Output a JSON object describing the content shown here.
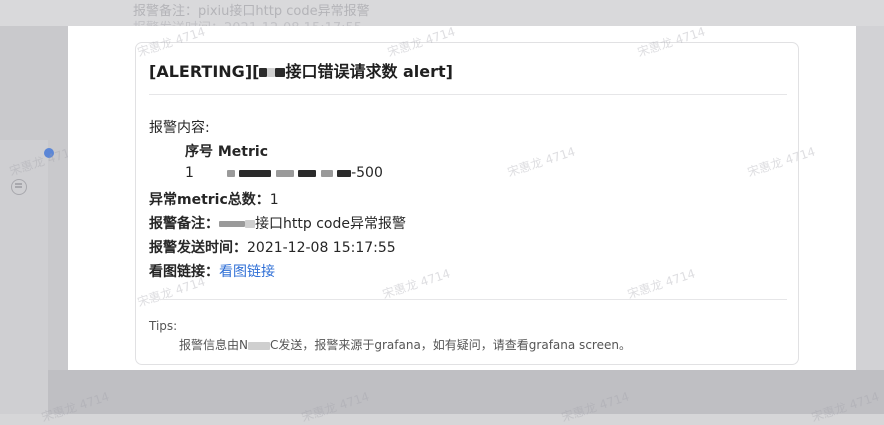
{
  "background": {
    "ghost_line1": "报警备注：pixiu接口http code异常报警",
    "ghost_line2": "报警发送时间：2021-12-08 15:17:55"
  },
  "card": {
    "title_prefix": "[ALERTING][",
    "title_suffix": "接口错误请求数 alert]",
    "content_label": "报警内容:",
    "table_header": "序号 Metric",
    "row_index": "1",
    "row_metric_suffix": "-500",
    "total_label": "异常metric总数：",
    "total_value": "1",
    "note_label": "报警备注：",
    "note_value_suffix": "接口http code异常报警",
    "time_label": "报警发送时间：",
    "time_value": "2021-12-08 15:17:55",
    "graph_label": "看图链接：",
    "graph_link": "看图链接",
    "tips_label": "Tips:",
    "tips_text_a": "报警信息由N",
    "tips_text_b": "C发送，报警来源于grafana，如有疑问，请查看grafana screen。"
  },
  "watermark": {
    "text": "宋惠龙 4714"
  },
  "colors": {
    "link": "#2f6fd6",
    "accent_dot": "#5b86d6"
  }
}
